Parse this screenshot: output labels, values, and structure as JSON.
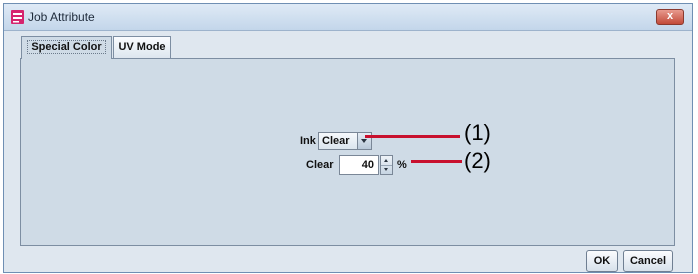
{
  "window": {
    "title": "Job Attribute",
    "close_label": "x"
  },
  "tabs": [
    {
      "label": "Special Color",
      "active": true
    },
    {
      "label": "UV Mode",
      "active": false
    }
  ],
  "form": {
    "ink_label": "Ink",
    "ink_value": "Clear",
    "clear_label": "Clear",
    "clear_value": "40",
    "clear_unit": "%"
  },
  "callouts": {
    "one": "(1)",
    "two": "(2)",
    "color": "#c8102e"
  },
  "buttons": {
    "ok": "OK",
    "cancel": "Cancel"
  },
  "icons": {
    "app": "job-attribute-app-icon",
    "close": "close-icon",
    "ink_dropdown": "chevron-down-icon",
    "spin_up": "spin-up-icon",
    "spin_down": "spin-down-icon"
  }
}
